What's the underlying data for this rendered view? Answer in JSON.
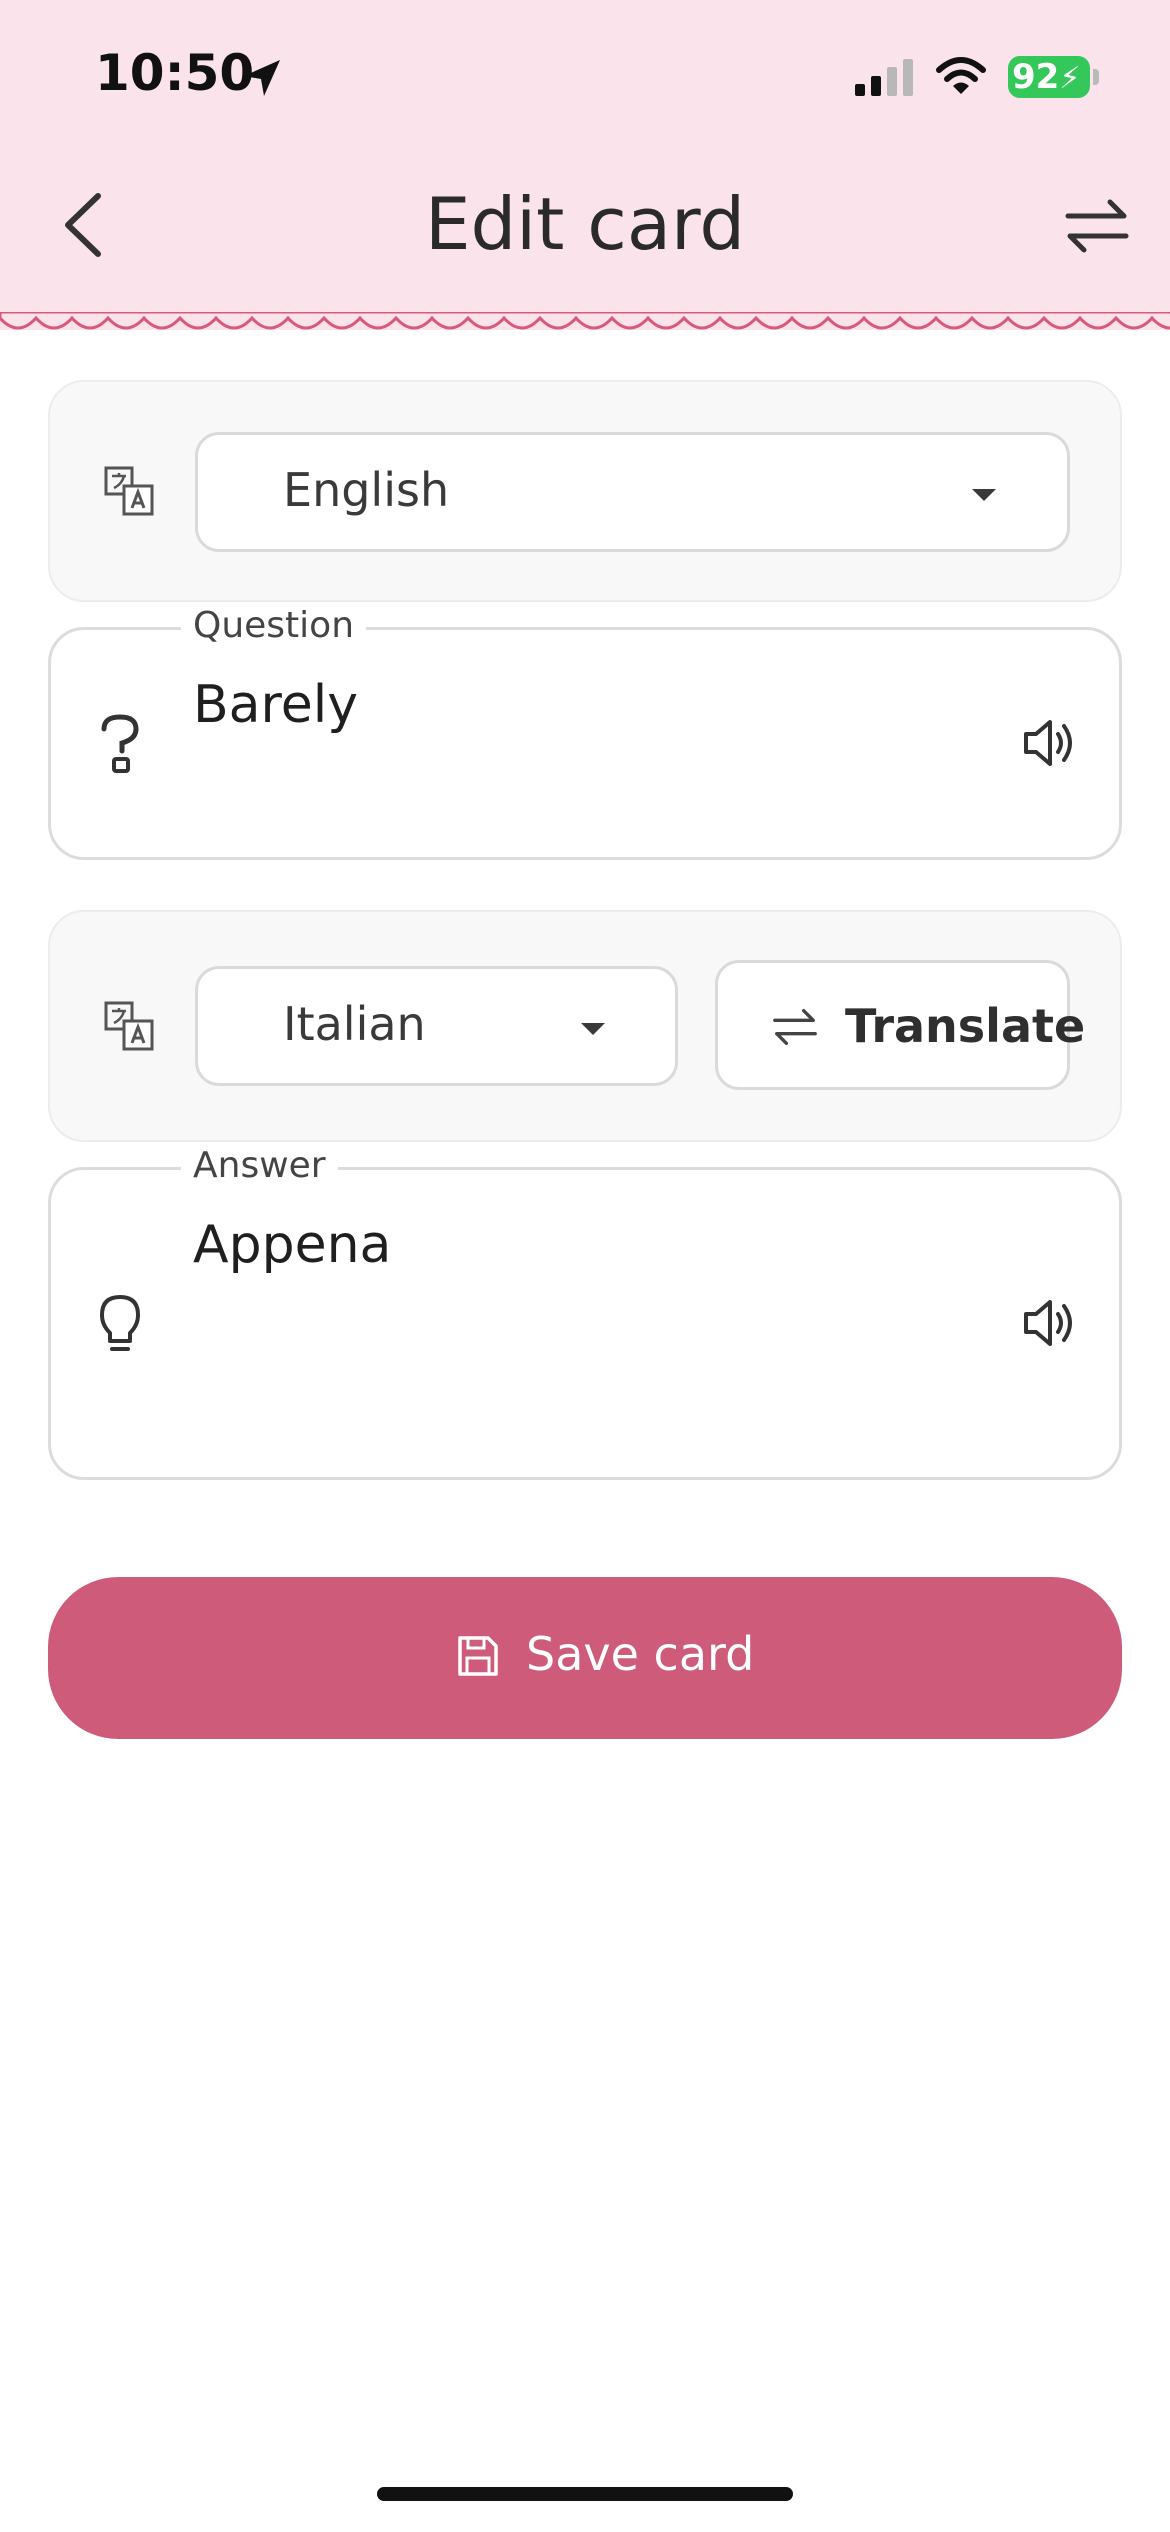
{
  "status_bar": {
    "time": "10:50",
    "battery": "92"
  },
  "header": {
    "title": "Edit card"
  },
  "question_section": {
    "language": "English",
    "label": "Question",
    "value": "Barely"
  },
  "answer_section": {
    "language": "Italian",
    "translate_label": "Translate",
    "label": "Answer",
    "value": "Appena"
  },
  "actions": {
    "save_label": "Save card"
  },
  "colors": {
    "header_bg": "#fae3ea",
    "wave": "#d9597c",
    "primary": "#ce5b7a",
    "battery": "#34c759"
  },
  "icons": {
    "location": "location-arrow-icon",
    "signal": "cellular-signal-icon",
    "wifi": "wifi-icon",
    "back": "chevron-left-icon",
    "swap": "swap-arrows-icon",
    "language": "translate-language-icon",
    "question": "question-mark-icon",
    "speaker": "speaker-icon",
    "answer": "lightbulb-icon",
    "save": "floppy-disk-icon"
  }
}
